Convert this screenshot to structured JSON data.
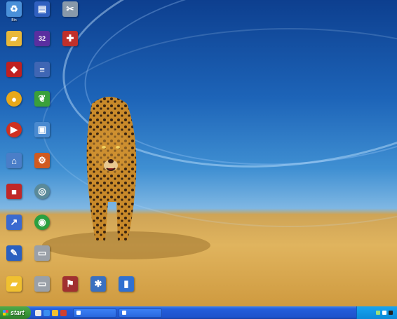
{
  "desktop": {
    "icons": [
      {
        "label": "Bin",
        "icon": "recycle-bin-icon",
        "color": "#4a90d9"
      },
      {
        "label": "",
        "icon": "program-icon",
        "color": "#3060c0"
      },
      {
        "label": "",
        "icon": "tool-icon",
        "color": "#8899aa"
      },
      {
        "label": "",
        "icon": "folder-icon",
        "color": "#e8b83a"
      },
      {
        "label": "",
        "icon": "app-32-icon",
        "color": "#5a2fa0"
      },
      {
        "label": "",
        "icon": "pin-icon",
        "color": "#c0302a"
      },
      {
        "label": "",
        "icon": "app-icon",
        "color": "#c02020"
      },
      {
        "label": "",
        "icon": "document-icon",
        "color": "#3f66b4"
      },
      {
        "label": "",
        "icon": "orb-icon",
        "color": "#e8a81a"
      },
      {
        "label": "",
        "icon": "leaf-icon",
        "color": "#3aa03a"
      },
      {
        "label": "",
        "icon": "media-icon",
        "color": "#d03020"
      },
      {
        "label": "",
        "icon": "window-icon",
        "color": "#4a8ad0"
      },
      {
        "label": "",
        "icon": "network-icon",
        "color": "#4a7ec8"
      },
      {
        "label": "",
        "icon": "setup-icon",
        "color": "#d05a20"
      },
      {
        "label": "",
        "icon": "toolbox-icon",
        "color": "#c02828"
      },
      {
        "label": "",
        "icon": "disc-icon",
        "color": "#5a8a9a"
      },
      {
        "label": "",
        "icon": "shortcut-icon",
        "color": "#3a6ad0"
      },
      {
        "label": "",
        "icon": "green-circle-icon",
        "color": "#2aa040"
      },
      {
        "label": "",
        "icon": "edit-icon",
        "color": "#2a60c0"
      },
      {
        "label": "",
        "icon": "drive-icon",
        "color": "#9aa0a8"
      },
      {
        "label": "",
        "icon": "folder-icon",
        "color": "#f0c030"
      },
      {
        "label": "",
        "icon": "drive-icon",
        "color": "#9aa0a8"
      },
      {
        "label": "",
        "icon": "flag-icon",
        "color": "#a03030"
      },
      {
        "label": "",
        "icon": "app-icon",
        "color": "#3a70c0"
      },
      {
        "label": "",
        "icon": "bottle-icon",
        "color": "#3070d0"
      }
    ]
  },
  "taskbar": {
    "start_label": "start",
    "tasks": [
      {
        "label": ""
      },
      {
        "label": ""
      }
    ],
    "clock": ""
  }
}
